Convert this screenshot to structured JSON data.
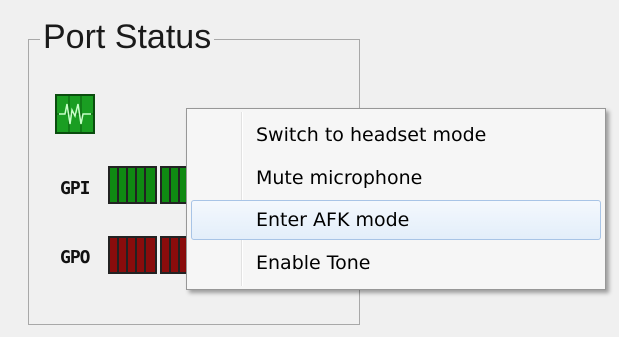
{
  "panel": {
    "title": "Port Status",
    "heartbeat_icon": "heartbeat-icon",
    "gpi_label": "GPI",
    "gpo_label": "GPO"
  },
  "context_menu": {
    "items": [
      {
        "label": "Switch to headset mode"
      },
      {
        "label": "Mute microphone"
      },
      {
        "label": "Enter AFK mode",
        "highlighted": true
      },
      {
        "label": "Enable Tone"
      }
    ]
  },
  "colors": {
    "gpi_active": "#0f8a12",
    "gpo_active": "#8a0c0c",
    "heartbeat": "#1a9e22",
    "highlight_border": "#a8c4e6"
  }
}
